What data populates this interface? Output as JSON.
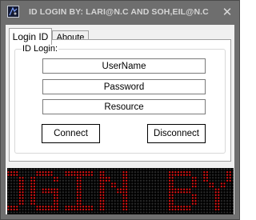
{
  "window": {
    "title": "ID LOGIN BY: LARI@N.C AND SOH,EIL@N.C",
    "close_glyph": "✕",
    "icon": "app-icon"
  },
  "tabs": [
    {
      "label": "Login ID",
      "active": true
    },
    {
      "label": "Aboute",
      "active": false
    }
  ],
  "login": {
    "group_label": "ID Login:",
    "username": {
      "value": "UserName"
    },
    "password": {
      "value": "Password"
    },
    "resource": {
      "value": "Resource"
    },
    "connect_label": "Connect",
    "disconnect_label": "Disconnect"
  },
  "marquee": {
    "text": "OGIN BY: LA",
    "color": "#e01515",
    "dim_color": "#2a2a2a",
    "background": "#000000"
  },
  "colors": {
    "titlebar": "#6e6e6e",
    "client": "#f0f0f0"
  }
}
